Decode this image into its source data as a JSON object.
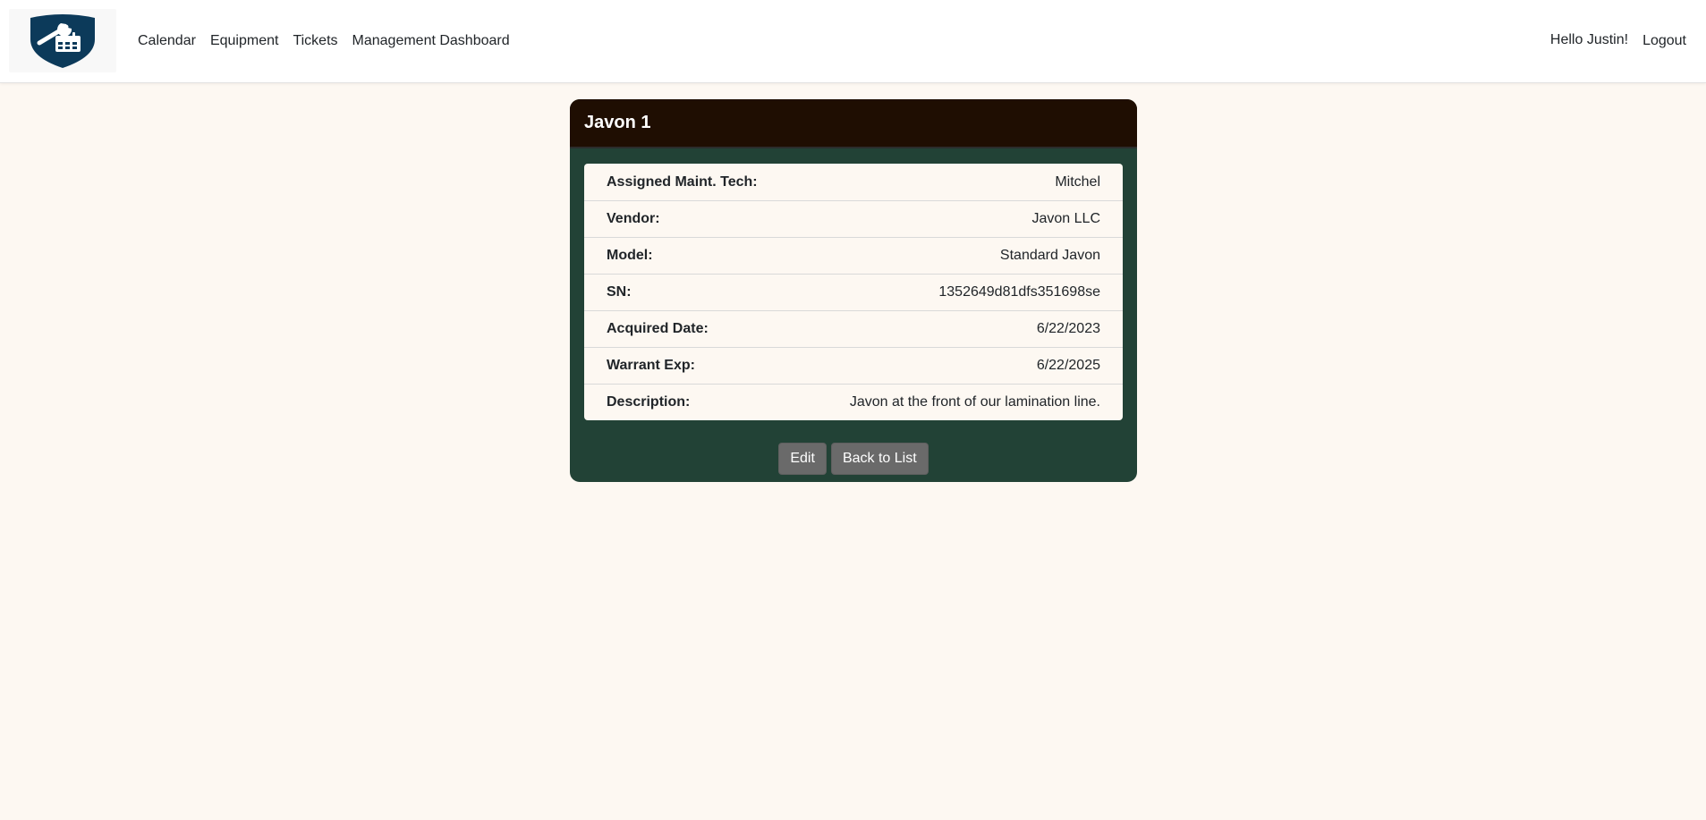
{
  "nav": {
    "links": [
      "Calendar",
      "Equipment",
      "Tickets",
      "Management Dashboard"
    ],
    "greeting": "Hello Justin!",
    "logout": "Logout"
  },
  "equipment": {
    "title": "Javon 1",
    "details": [
      {
        "label": "Assigned Maint. Tech:",
        "value": "Mitchel"
      },
      {
        "label": "Vendor:",
        "value": "Javon LLC"
      },
      {
        "label": "Model:",
        "value": "Standard Javon"
      },
      {
        "label": "SN:",
        "value": "1352649d81dfs351698se"
      },
      {
        "label": "Acquired Date:",
        "value": "6/22/2023"
      },
      {
        "label": "Warrant Exp:",
        "value": "6/22/2025"
      },
      {
        "label": "Description:",
        "value": "Javon at the front of our lamination line."
      }
    ],
    "edit_label": "Edit",
    "back_label": "Back to List"
  },
  "icons": {
    "logo": "shield-wrench-calendar-icon"
  },
  "colors": {
    "page_bg": "#fdf8f2",
    "card_bg": "#224236",
    "card_header": "#1f0e02",
    "button": "#6a6a6a",
    "logo_shield": "#0c3a5a"
  }
}
